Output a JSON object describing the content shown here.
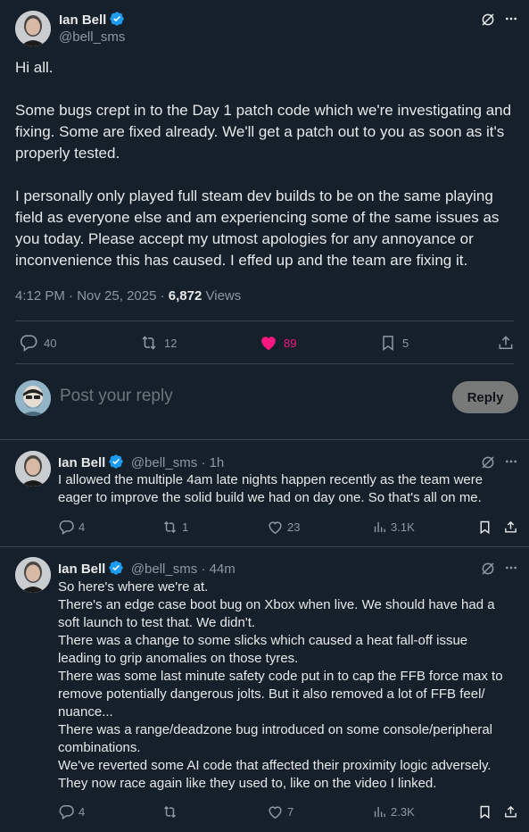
{
  "tweet": {
    "author_name": "Ian Bell",
    "author_handle": "@bell_sms",
    "paragraphs": [
      "Hi all.",
      "Some bugs crept in to the Day 1 patch code which we're investigating and fixing. Some are fixed already. We'll get a patch out to you as soon as it's properly tested.",
      "I personally only played full steam dev builds to be on the same playing field as everyone else and am experiencing some of the same issues as you today. Please accept my utmost apologies for any annoyance or inconvenience this has caused. I effed up and the team are fixing it."
    ],
    "time": "4:12 PM",
    "date": "Nov 25, 2025",
    "views_count": "6,872",
    "views_label": "Views",
    "replies": "40",
    "reposts": "12",
    "likes": "89",
    "bookmarks": "5"
  },
  "composer": {
    "placeholder": "Post your reply",
    "button_label": "Reply"
  },
  "replies": [
    {
      "author_name": "Ian Bell",
      "author_handle": "@bell_sms",
      "age": "1h",
      "lines": [
        "I allowed the multiple 4am late nights happen recently as the team were",
        "eager to improve the solid build we had on day one. So that's all on me."
      ],
      "replies": "4",
      "reposts": "1",
      "likes": "23",
      "views": "3.1K"
    },
    {
      "author_name": "Ian Bell",
      "author_handle": "@bell_sms",
      "age": "44m",
      "lines": [
        "So here's where we're at.",
        "There's an edge case boot bug on Xbox when live. We should have had a",
        "soft launch to test that. We didn't.",
        "There was a change to some slicks which caused a heat fall-off issue",
        "leading to grip anomalies on those tyres.",
        "There was some last minute safety code put in to cap the FFB force max to",
        "remove potentially dangerous jolts. But it also removed a lot of FFB feel/",
        "nuance...",
        "There was a range/deadzone bug introduced on some console/peripheral",
        "combinations.",
        "We've reverted some AI code that affected their proximity logic adversely.",
        "They now race again like they used to, like on the video I linked."
      ],
      "replies": "4",
      "reposts": "",
      "likes": "7",
      "views": "2.3K"
    }
  ],
  "colors": {
    "background": "#15202b",
    "text": "#e7e9ea",
    "muted": "#8b98a5",
    "border": "#38444d",
    "verified": "#1d9bf0",
    "like": "#f91880"
  }
}
